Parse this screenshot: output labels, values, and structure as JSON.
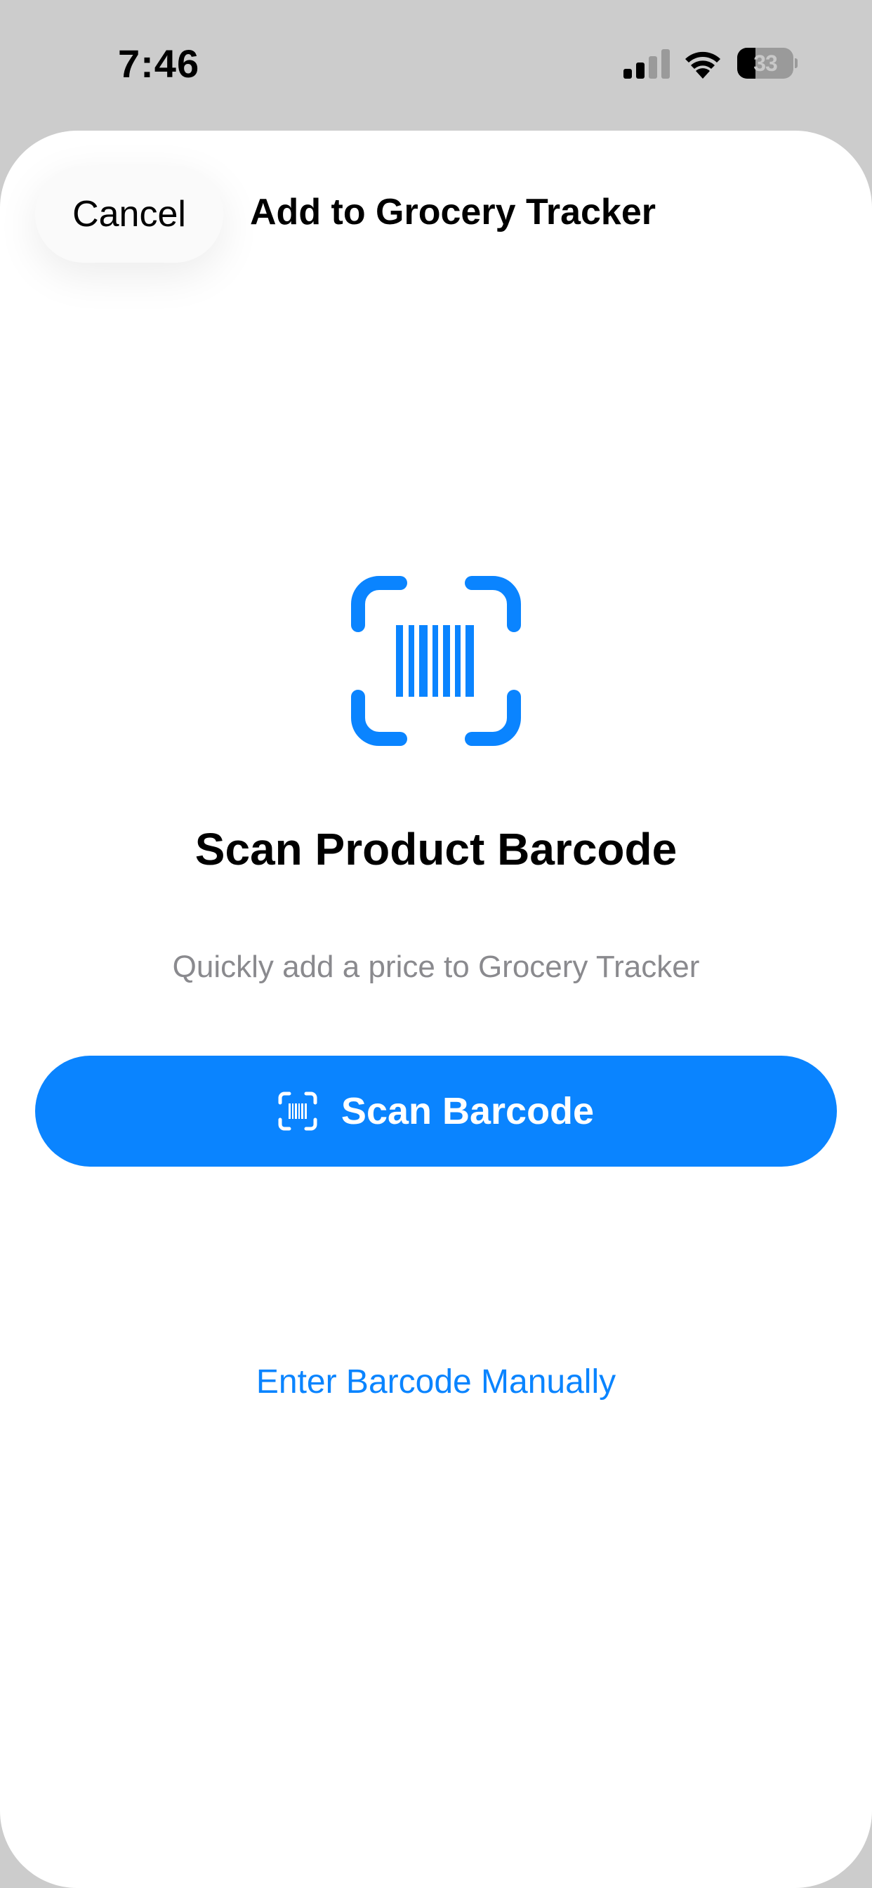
{
  "status_bar": {
    "time": "7:46",
    "battery_level": "33",
    "battery_fraction": 0.33,
    "signal_bars_filled": 2,
    "signal_bars_total": 4
  },
  "sheet": {
    "cancel_label": "Cancel",
    "title": "Add to Grocery Tracker"
  },
  "main": {
    "heading": "Scan Product Barcode",
    "subtitle": "Quickly add a price to Grocery Tracker",
    "scan_button_label": "Scan Barcode",
    "manual_link_label": "Enter Barcode Manually",
    "graphic_icon": "barcode-viewfinder-icon"
  },
  "colors": {
    "accent": "#0a84ff",
    "page_background": "#cccccc",
    "sheet_background": "#ffffff",
    "secondary_text": "#8a8a8e"
  }
}
